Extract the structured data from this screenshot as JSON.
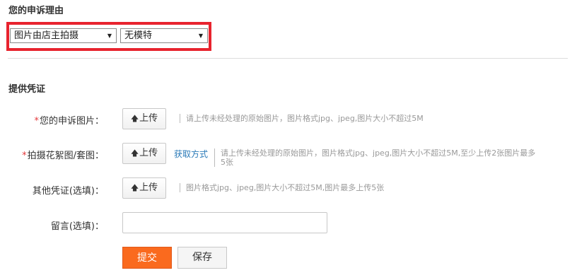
{
  "reason": {
    "title": "您的申诉理由",
    "select1": "图片由店主拍摄",
    "select2": "无模特"
  },
  "section": {
    "title": "提供凭证"
  },
  "rows": [
    {
      "required": "*",
      "label": "您的申诉图片：",
      "upload": "上传",
      "hint": "请上传未经处理的原始图片，图片格式jpg、jpeg,图片大小不超过5M"
    },
    {
      "required": "*",
      "label": "拍摄花絮图/套图：",
      "upload": "上传",
      "link": "获取方式",
      "hint_line1": "请上传未经处理的原始图片，图片格式jpg、jpeg,图片大小不超过5M,至少上传2张图片最多",
      "hint_line2": "5张"
    },
    {
      "label": "其他凭证(选填)：",
      "upload": "上传",
      "hint": "图片格式jpg、jpeg,图片大小不超过5M,图片最多上传5张"
    }
  ],
  "note": {
    "label": "留言(选填)：",
    "value": ""
  },
  "actions": {
    "submit": "提交",
    "save": "保存"
  },
  "icons": {
    "upload": "up-arrow-icon",
    "dropdown": "caret-down-icon"
  },
  "colors": {
    "highlight": "#e8232e",
    "submit": "#fa6a1e",
    "required": "#e4393c",
    "link": "#2a7ab8"
  }
}
